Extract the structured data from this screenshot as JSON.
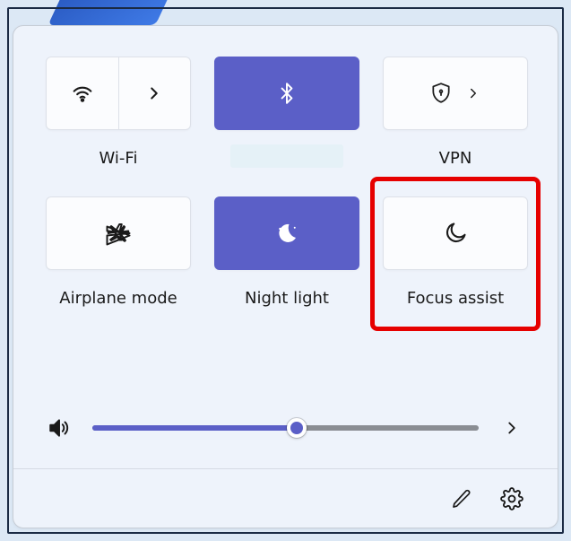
{
  "colors": {
    "accent": "#5b5fc7",
    "highlight": "#e60000",
    "panel_bg": "#eef3fb"
  },
  "tiles": {
    "wifi": {
      "label": "Wi-Fi",
      "active": false,
      "has_expand": true
    },
    "bluetooth": {
      "label": "",
      "active": true
    },
    "vpn": {
      "label": "VPN",
      "active": false,
      "has_expand": true
    },
    "airplane": {
      "label": "Airplane mode",
      "active": false
    },
    "nightlight": {
      "label": "Night light",
      "active": true
    },
    "focusassist": {
      "label": "Focus assist",
      "active": false,
      "highlighted": true
    }
  },
  "volume": {
    "percent": 53
  },
  "bottom": {
    "edit": "edit",
    "settings": "settings"
  }
}
